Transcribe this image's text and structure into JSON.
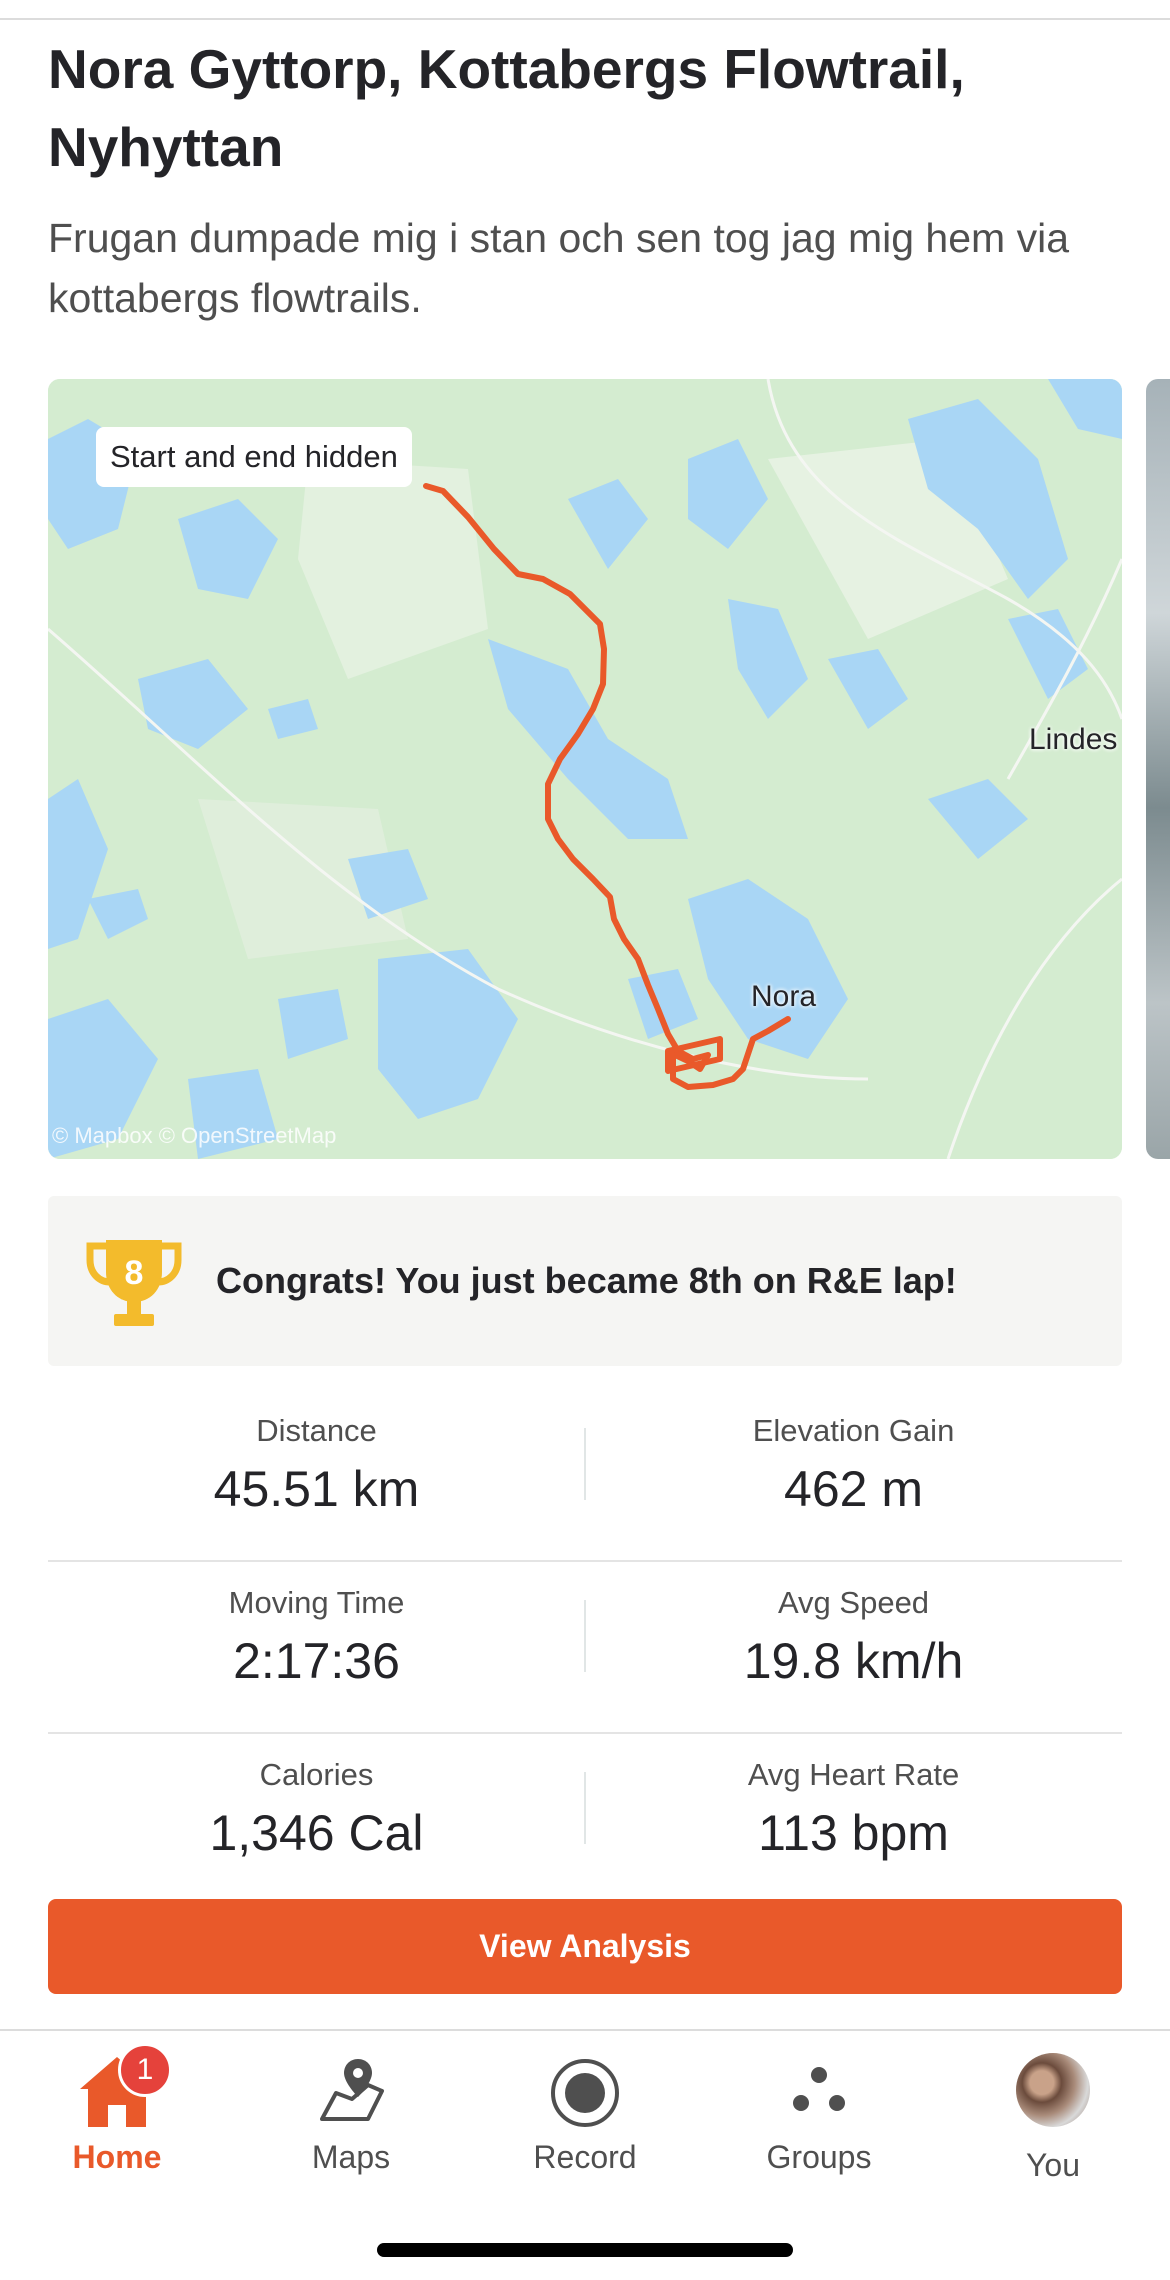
{
  "activity": {
    "title": "Nora Gyttorp, Kottabergs Flowtrail, Nyhyttan",
    "description": "Frugan dumpade mig i stan och sen tog jag mig hem via kottabergs flowtrails."
  },
  "map": {
    "privacy_badge": "Start and end hidden",
    "place_labels": {
      "nora": "Nora",
      "lindes": "Lindes"
    },
    "attribution": "© Mapbox © OpenStreetMap",
    "route_color": "#e9592a",
    "land_color": "#d4ecd0",
    "water_color": "#a9d6f5"
  },
  "achievement": {
    "icon": "trophy-icon",
    "rank_number": "8",
    "text": "Congrats! You just became 8th on R&E lap!"
  },
  "stats": {
    "distance": {
      "label": "Distance",
      "value": "45.51 km"
    },
    "elevation": {
      "label": "Elevation Gain",
      "value": "462 m"
    },
    "moving_time": {
      "label": "Moving Time",
      "value": "2:17:36"
    },
    "avg_speed": {
      "label": "Avg Speed",
      "value": "19.8 km/h"
    },
    "calories": {
      "label": "Calories",
      "value": "1,346 Cal"
    },
    "avg_hr": {
      "label": "Avg Heart Rate",
      "value": "113 bpm"
    }
  },
  "actions": {
    "view_analysis": "View Analysis"
  },
  "tabs": {
    "home": {
      "label": "Home",
      "badge": "1",
      "icon": "home-icon"
    },
    "maps": {
      "label": "Maps",
      "icon": "maps-icon"
    },
    "record": {
      "label": "Record",
      "icon": "record-icon"
    },
    "groups": {
      "label": "Groups",
      "icon": "groups-icon"
    },
    "you": {
      "label": "You",
      "icon": "avatar"
    }
  },
  "colors": {
    "accent": "#e9592a",
    "badge": "#e5423b"
  }
}
